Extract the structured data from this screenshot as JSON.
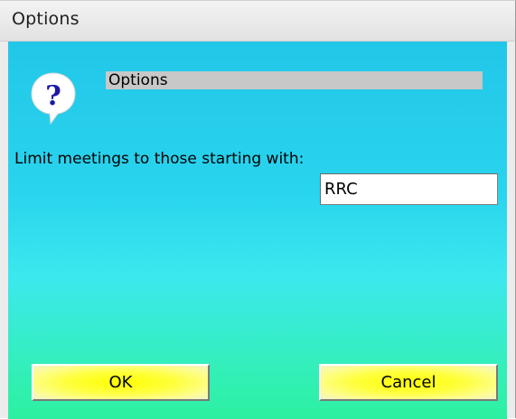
{
  "window": {
    "title": "Options"
  },
  "dialog": {
    "header_text": "Options",
    "icon": "help-question-icon",
    "limit_label": "Limit meetings to those starting with:",
    "prefix_value": "RRC",
    "ok_label": "OK",
    "cancel_label": "Cancel"
  },
  "colors": {
    "client_top": "#22c7e8",
    "client_bottom": "#2cf0a0",
    "button_face": "#ffff00",
    "header_bar": "#c8c8c8",
    "icon_blue": "#1a1aa8"
  }
}
